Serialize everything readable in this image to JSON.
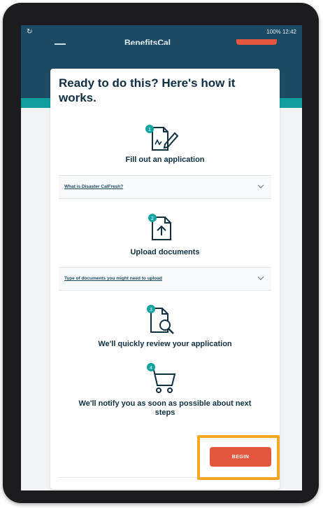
{
  "status_bar": {
    "sync_icon": "sync-icon",
    "right_text": "100% 12:42"
  },
  "header": {
    "logo_text": "BenefitsCal",
    "menu_icon": "hamburger-icon"
  },
  "card": {
    "heading": "Ready to do this? Here's how it works.",
    "steps": [
      {
        "number": "1",
        "icon": "edit-document-icon",
        "title": "Fill out an application"
      },
      {
        "number": "2",
        "icon": "upload-document-icon",
        "title": "Upload documents"
      },
      {
        "number": "3",
        "icon": "review-document-icon",
        "title": "We'll quickly review your application"
      },
      {
        "number": "4",
        "icon": "cart-icon",
        "title": "We'll notify you as soon as possible about next steps"
      }
    ],
    "accordions": [
      {
        "label": "What is Disaster CalFresh?"
      },
      {
        "label": "Type of documents you might need to upload"
      }
    ],
    "begin_label": "BEGIN"
  },
  "colors": {
    "header": "#1c4b63",
    "teal": "#129e9e",
    "accent": "#e4573f",
    "highlight": "#f5a623",
    "badge": "#14a3a3"
  }
}
